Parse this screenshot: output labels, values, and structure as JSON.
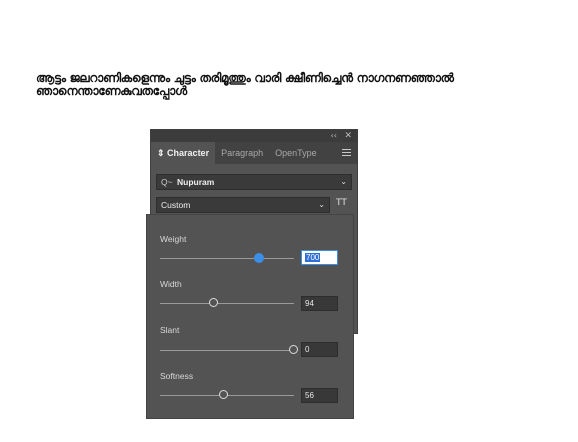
{
  "headline": "ആട്ടം ജലറാണികളെന്നും ചുട്ടം തരിമൂത്തും വാരി ക്ഷീണിച്ചെൻ നാഗനണഞ്ഞാൽ ഞാനെന്താണേകുവതപ്പോൾ",
  "panel": {
    "collapse_glyph": "‹‹",
    "close_glyph": "✕",
    "tabs": [
      {
        "label": "Character",
        "prefix": "⇕ ",
        "active": true
      },
      {
        "label": "Paragraph",
        "active": false
      },
      {
        "label": "OpenType",
        "active": false
      }
    ],
    "font_name": "Nupuram",
    "search_glyph": "Q~",
    "font_style": "Custom",
    "variable_icon": "TT",
    "chevron": "⌄"
  },
  "axes": [
    {
      "label": "Weight",
      "value": "700",
      "fraction": 0.74,
      "active": true
    },
    {
      "label": "Width",
      "value": "94",
      "fraction": 0.4,
      "active": false
    },
    {
      "label": "Slant",
      "value": "0",
      "fraction": 1.0,
      "active": false
    },
    {
      "label": "Softness",
      "value": "56",
      "fraction": 0.48,
      "active": false
    }
  ],
  "colors": {
    "panel": "#535353",
    "accent": "#3b8fe8"
  }
}
